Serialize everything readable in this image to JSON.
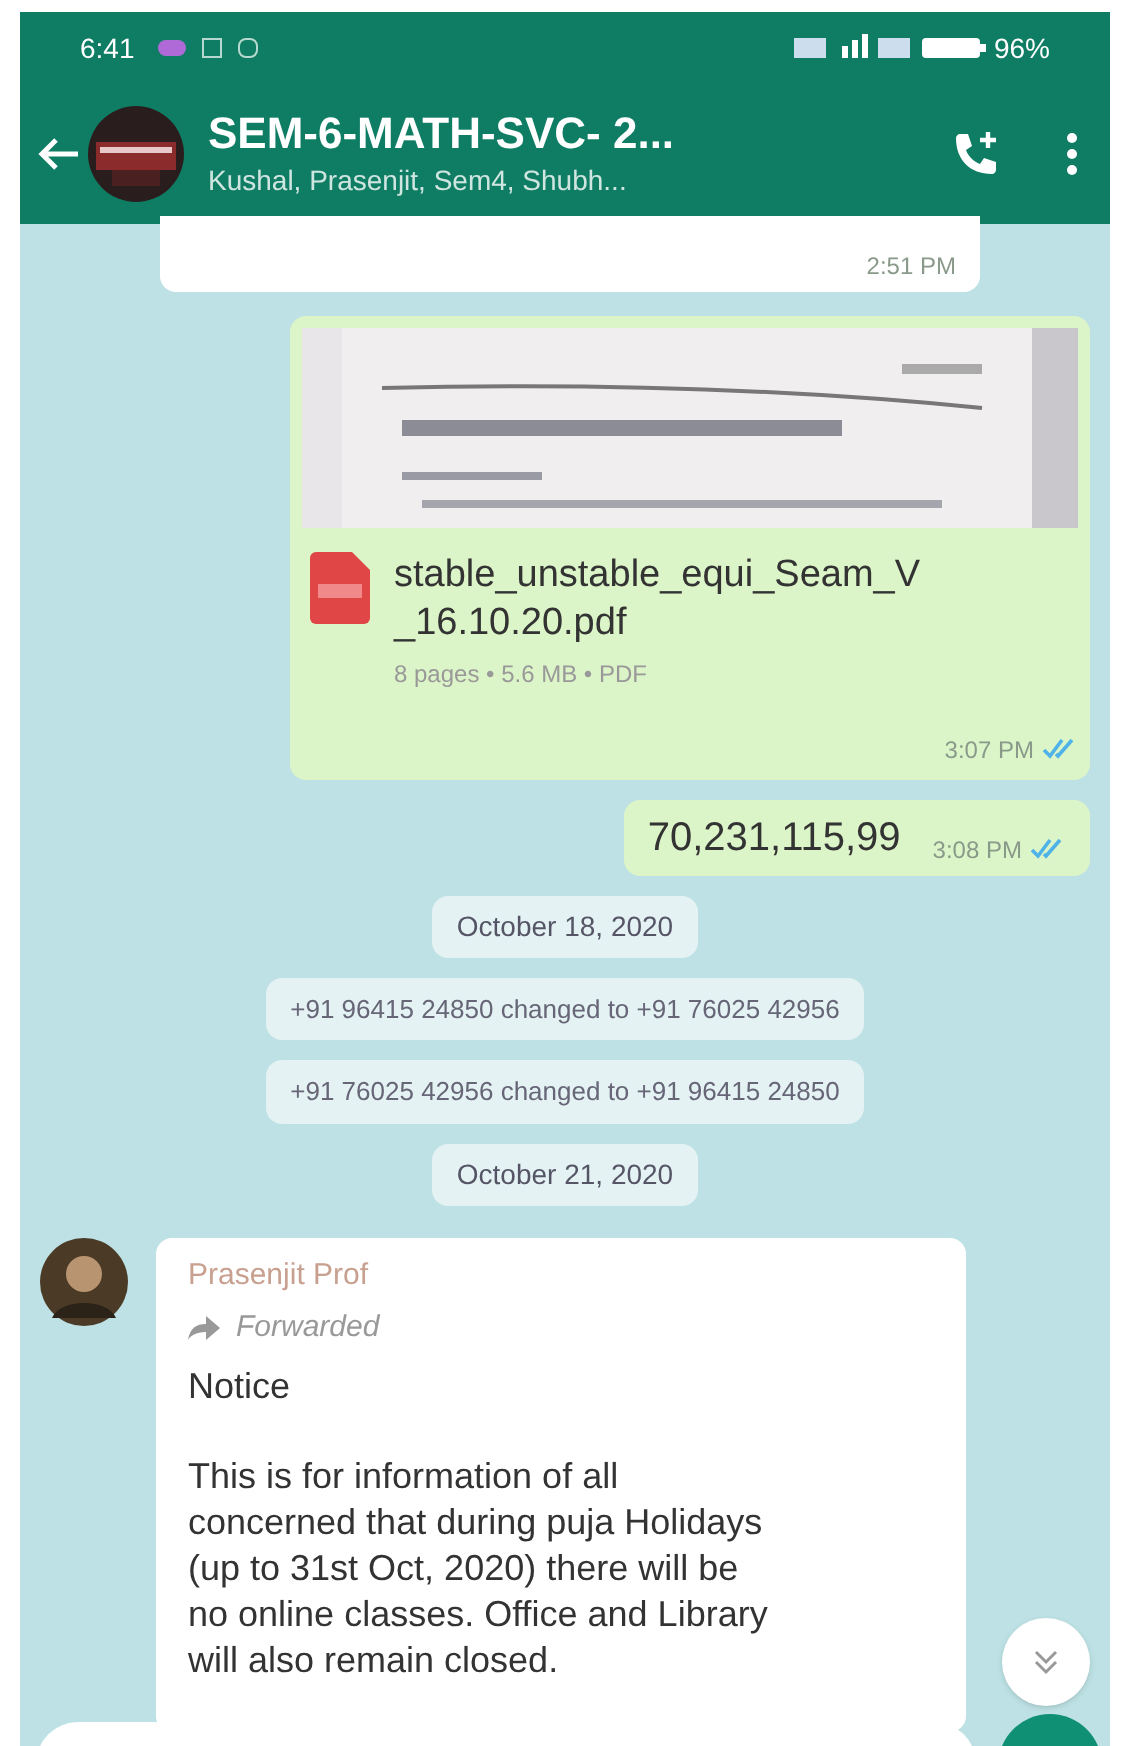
{
  "status_bar": {
    "time": "6:41",
    "battery": "96%"
  },
  "header": {
    "title": "SEM-6-MATH-SVC- 2...",
    "subtitle": "Kushal, Prasenjit, Sem4, Shubh..."
  },
  "messages": [
    {
      "kind": "time_only",
      "outgoing": false,
      "time": "2:51 PM"
    },
    {
      "kind": "document",
      "outgoing": true,
      "file_name": "stable_unstable_equi_Seam_V_16.10.20.pdf",
      "file_info": "8 pages • 5.6 MB • PDF",
      "time": "3:07 PM",
      "read": true
    },
    {
      "kind": "text",
      "outgoing": true,
      "text": "70,231,115,99",
      "time": "3:08 PM",
      "read": true
    },
    {
      "kind": "date",
      "text": "October 18, 2020"
    },
    {
      "kind": "system",
      "text": "+91 96415 24850 changed to +91 76025 42956"
    },
    {
      "kind": "system",
      "text": "+91 76025 42956 changed to +91 96415 24850"
    },
    {
      "kind": "date",
      "text": "October 21, 2020"
    },
    {
      "kind": "notice",
      "outgoing": false,
      "sender": "Prasenjit Prof",
      "forwarded": true,
      "forwarded_label": "Forwarded",
      "title": "Notice",
      "text": "This is for information of all concerned that during puja Holidays  (up to 31st Oct, 2020) there will be no online classes. Office and Library will also remain closed."
    }
  ]
}
